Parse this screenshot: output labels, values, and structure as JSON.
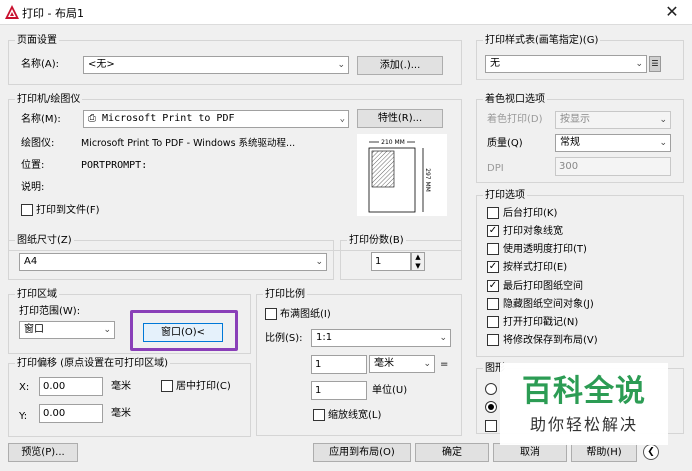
{
  "window": {
    "title": "打印 - 布局1",
    "close": "✕"
  },
  "page_setup": {
    "title": "页面设置",
    "name_label": "名称(A):",
    "name_value": "<无>",
    "add_button": "添加(.)..."
  },
  "printer": {
    "title": "打印机/绘图仪",
    "name_label": "名称(M):",
    "name_value": "Microsoft Print to PDF",
    "properties_button": "特性(R)...",
    "plotter_label": "绘图仪:",
    "plotter_value": "Microsoft Print To PDF - Windows 系统驱动程...",
    "location_label": "位置:",
    "location_value": "PORTPROMPT:",
    "description_label": "说明:",
    "print_to_file_label": "打印到文件(F)",
    "print_to_file": false,
    "preview_width": "210 MM",
    "preview_height": "297 MM"
  },
  "paper_size": {
    "title": "图纸尺寸(Z)",
    "value": "A4"
  },
  "copies": {
    "title": "打印份数(B)",
    "value": "1"
  },
  "print_area": {
    "title": "打印区域",
    "range_label": "打印范围(W):",
    "range_value": "窗口",
    "window_button": "窗口(O)<",
    "highlight_color": "#8a3fb8"
  },
  "print_scale": {
    "title": "打印比例",
    "fit_paper_label": "布满图纸(I)",
    "fit_paper": false,
    "scale_label": "比例(S):",
    "scale_value": "1:1",
    "value1": "1",
    "unit_value": "毫米",
    "equals": "=",
    "value2": "1",
    "unit_label": "单位(U)",
    "scale_lineweights_label": "缩放线宽(L)",
    "scale_lineweights": false
  },
  "print_offset": {
    "title": "打印偏移 (原点设置在可打印区域)",
    "x_label": "X:",
    "x_value": "0.00",
    "y_label": "Y:",
    "y_value": "0.00",
    "unit": "毫米",
    "center_label": "居中打印(C)",
    "center": false
  },
  "plot_style": {
    "title": "打印样式表(画笔指定)(G)",
    "value": "无"
  },
  "shaded_viewport": {
    "title": "着色视口选项",
    "shade_label": "着色打印(D)",
    "shade_value": "按显示",
    "quality_label": "质量(Q)",
    "quality_value": "常规",
    "dpi_label": "DPI",
    "dpi_value": "300"
  },
  "plot_options": {
    "title": "打印选项",
    "items": [
      {
        "label": "后台打印(K)",
        "checked": false
      },
      {
        "label": "打印对象线宽",
        "checked": true
      },
      {
        "label": "使用透明度打印(T)",
        "checked": false
      },
      {
        "label": "按样式打印(E)",
        "checked": true
      },
      {
        "label": "最后打印图纸空间",
        "checked": true
      },
      {
        "label": "隐藏图纸空间对象(J)",
        "checked": false
      },
      {
        "label": "打开打印戳记(N)",
        "checked": false
      },
      {
        "label": "将修改保存到布局(V)",
        "checked": false
      }
    ]
  },
  "orientation": {
    "title": "图形"
  },
  "buttons": {
    "preview": "预览(P)...",
    "apply": "应用到布局(O)",
    "ok": "确定",
    "cancel": "取消",
    "help": "帮助(H)"
  },
  "watermark": {
    "big": "百科全说",
    "small": "助你轻松解决",
    "color": "#2c9c54"
  }
}
